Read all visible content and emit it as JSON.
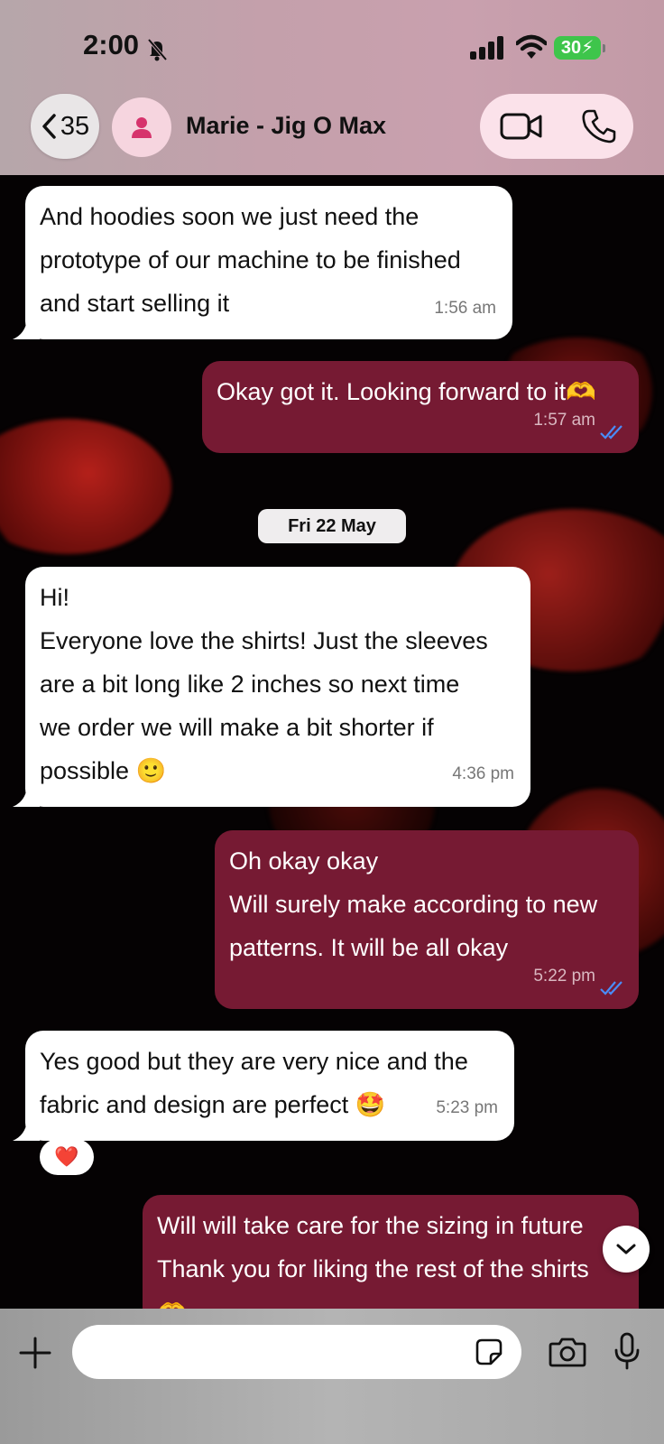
{
  "status_bar": {
    "time": "2:00",
    "battery": "30"
  },
  "header": {
    "back_count": "35",
    "contact_name": "Marie - Jig O Max"
  },
  "messages": [
    {
      "dir": "in",
      "lines": [
        "And hoodies soon we just need the",
        "prototype of our machine to be finished",
        "and start selling it"
      ],
      "time": "1:56 am"
    },
    {
      "dir": "out",
      "lines": [
        "Okay got it. Looking forward to it🫶"
      ],
      "time": "1:57 am"
    },
    {
      "dir": "in",
      "lines": [
        "Hi!",
        "Everyone love the shirts! Just the sleeves",
        "are a bit long like 2 inches so next time",
        "we order we will make a bit shorter if",
        "possible 🙂"
      ],
      "time": "4:36 pm"
    },
    {
      "dir": "out",
      "lines": [
        "Oh okay okay",
        "Will surely make according to new",
        "patterns. It will be all okay"
      ],
      "time": "5:22 pm"
    },
    {
      "dir": "in",
      "lines": [
        "Yes good but they are very nice and the",
        "fabric and design are perfect 🤩"
      ],
      "time": "5:23 pm"
    },
    {
      "dir": "out",
      "lines": [
        "Will will take care for the sizing in future",
        "Thank you for liking the rest of the shirts",
        "🫶"
      ],
      "time": ""
    }
  ],
  "date_chip": "Fri 22 May",
  "reaction": "❤️",
  "composer": {
    "placeholder": ""
  },
  "colors": {
    "outgoing": "#761a33",
    "incoming": "#ffffff",
    "ticks": "#4a8cf7"
  }
}
